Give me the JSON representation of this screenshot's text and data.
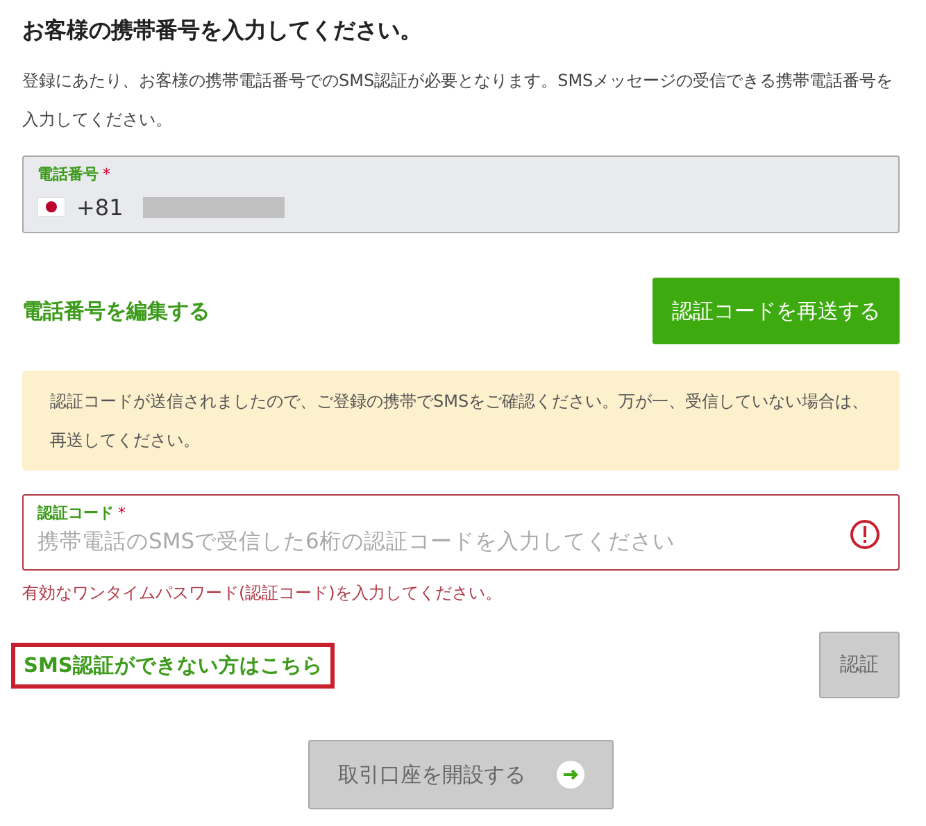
{
  "heading": "お客様の携帯番号を入力してください。",
  "description": "登録にあたり、お客様の携帯電話番号でのSMS認証が必要となります。SMSメッセージの受信できる携帯電話番号を入力してください。",
  "phone_field": {
    "label": "電話番号",
    "required_mark": "*",
    "country_code": "+81",
    "disabled": true
  },
  "edit_link": "電話番号を編集する",
  "resend_button": {
    "label": "認証コードを再送する",
    "disabled": false
  },
  "notice": "認証コードが送信されましたので、ご登録の携帯でSMSをご確認ください。万が一、受信していない場合は、再送してください。",
  "code_field": {
    "label": "認証コード",
    "required_mark": "*",
    "placeholder": "携帯電話のSMSで受信した6桁の認証コードを入力してください",
    "error": true
  },
  "error_message": "有効なワンタイムパスワード(認証コード)を入力してください。",
  "sms_help_link": {
    "label": "SMS認証ができない方はこちら",
    "highlighted": true
  },
  "verify_button": {
    "label": "認証",
    "disabled": true
  },
  "open_account_button": {
    "label": "取引口座を開設する",
    "disabled": true
  }
}
